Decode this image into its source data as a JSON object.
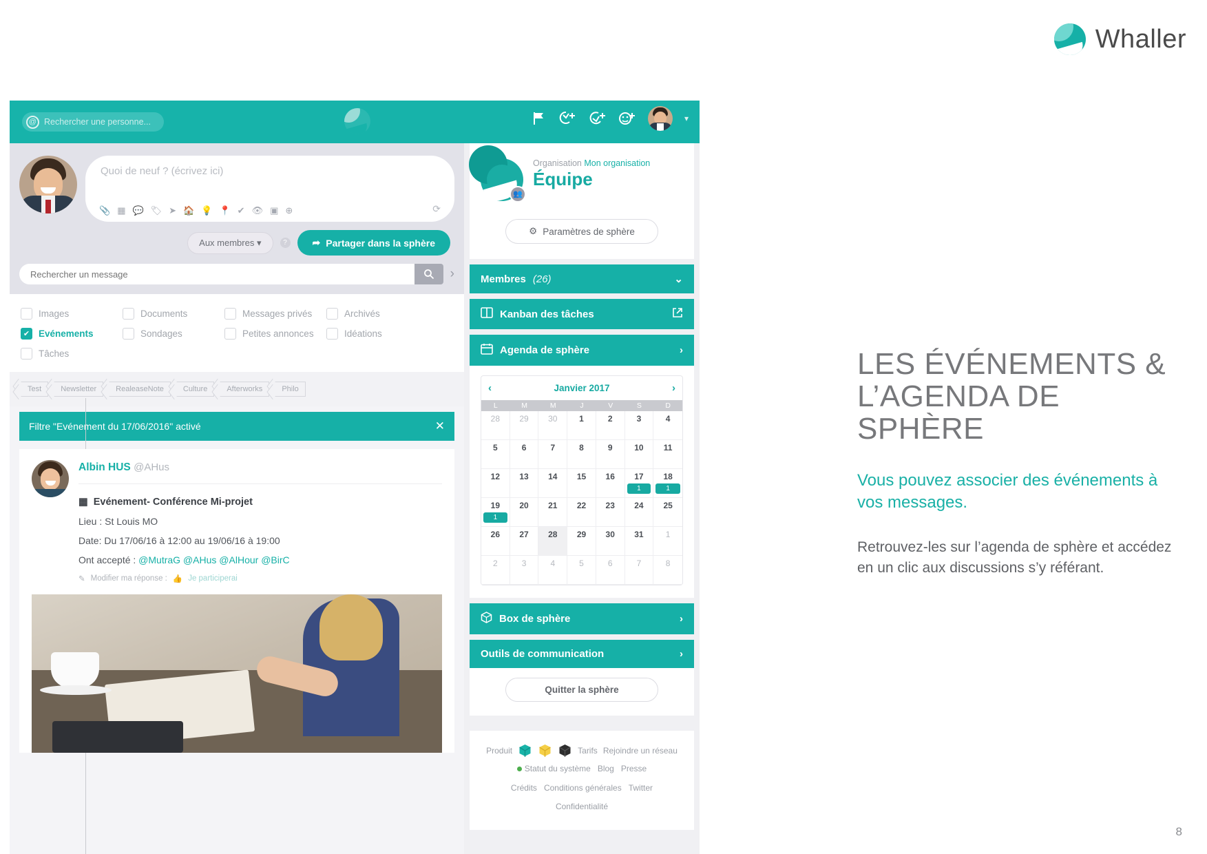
{
  "brand": {
    "name": "Whaller",
    "logo_icon": "whaller-logo-icon",
    "color": "#16b0a7"
  },
  "page_number": "8",
  "topbar": {
    "search_placeholder": "Rechercher une personne...",
    "search_icon": "at-search-icon",
    "logo_icon": "whaller-mark-icon",
    "icons": [
      "flag-icon",
      "add-sphere-icon",
      "add-circle-icon",
      "add-contact-icon"
    ],
    "avatar_icon": "user-avatar",
    "caret_icon": "chevron-down-icon"
  },
  "composer": {
    "avatar_icon": "user-avatar",
    "placeholder": "Quoi de neuf ? (écrivez ici)",
    "tools": [
      "attach-icon",
      "calendar-icon",
      "comment-icon",
      "tag-icon",
      "send-icon",
      "poll-icon",
      "idea-icon",
      "location-icon",
      "check-icon",
      "eye-icon",
      "media-icon",
      "plus-icon"
    ],
    "refresh_icon": "refresh-icon",
    "audience_label": "Aux membres",
    "audience_caret": "caret-down-icon",
    "help_icon": "help-icon",
    "share_label": "Partager dans la sphère",
    "share_icon": "share-arrow-icon"
  },
  "message_search": {
    "placeholder": "Rechercher un message",
    "value": "",
    "search_icon": "magnifier-icon",
    "next_icon": "chevron-right-icon"
  },
  "filters": [
    {
      "label": "Images",
      "checked": false
    },
    {
      "label": "Documents",
      "checked": false
    },
    {
      "label": "Messages privés",
      "checked": false
    },
    {
      "label": "Archivés",
      "checked": false
    },
    {
      "label": "Evénements",
      "checked": true
    },
    {
      "label": "Sondages",
      "checked": false
    },
    {
      "label": "Petites annonces",
      "checked": false
    },
    {
      "label": "Idéations",
      "checked": false
    },
    {
      "label": "Tâches",
      "checked": false
    }
  ],
  "tags": [
    "Test",
    "Newsletter",
    "RealeaseNote",
    "Culture",
    "Afterworks",
    "Philo"
  ],
  "filter_banner": {
    "text": "Filtre \"Evénement du 17/06/2016\" activé",
    "close_icon": "close-icon"
  },
  "post": {
    "avatar_icon": "user-avatar",
    "author": "Albin HUS",
    "handle": "@AHus",
    "event_icon": "calendar-icon",
    "title": "Evénement- Conférence Mi-projet",
    "place": "Lieu : St Louis MO",
    "date": "Date: Du 17/06/16 à 12:00 au 19/06/16 à 19:00",
    "accepted_label": "Ont accepté :",
    "accepted": [
      "@MutraG",
      "@AHus",
      "@AlHour",
      "@BirC"
    ],
    "response_icon": "pencil-icon",
    "response_label": "Modifier ma réponse :",
    "response_value_icon": "thumb-icon",
    "response_value": "Je participerai",
    "photo_alt": "photo-meeting-coffee"
  },
  "sphere": {
    "logo_icon": "sphere-logo-icon",
    "badge_icon": "group-icon",
    "org_label": "Organisation",
    "org_name": "Mon organisation",
    "name": "Équipe",
    "settings_label": "Paramètres de sphère",
    "settings_icon": "gear-icon",
    "rows": [
      {
        "label": "Membres",
        "count": "(26)",
        "icon": null,
        "right_icon": "chevron-down-icon"
      },
      {
        "label": "Kanban des tâches",
        "count": "",
        "icon": "columns-icon",
        "right_icon": "external-link-icon"
      },
      {
        "label": "Agenda de sphère",
        "count": "",
        "icon": "calendar-icon",
        "right_icon": "chevron-right-icon"
      }
    ],
    "rows_after": [
      {
        "label": "Box de sphère",
        "icon": "box-icon",
        "right_icon": "chevron-right-icon"
      },
      {
        "label": "Outils de communication",
        "icon": null,
        "right_icon": "chevron-right-icon"
      }
    ],
    "quit_label": "Quitter la sphère"
  },
  "calendar": {
    "month": "Janvier 2017",
    "prev_icon": "chevron-left-icon",
    "next_icon": "chevron-right-icon",
    "dow": [
      "L",
      "M",
      "M",
      "J",
      "V",
      "S",
      "D"
    ],
    "weeks": [
      [
        {
          "d": "28",
          "muted": true
        },
        {
          "d": "29",
          "muted": true
        },
        {
          "d": "30",
          "muted": true
        },
        {
          "d": "1"
        },
        {
          "d": "2"
        },
        {
          "d": "3"
        },
        {
          "d": "4"
        }
      ],
      [
        {
          "d": "5"
        },
        {
          "d": "6"
        },
        {
          "d": "7"
        },
        {
          "d": "8"
        },
        {
          "d": "9"
        },
        {
          "d": "10"
        },
        {
          "d": "11"
        }
      ],
      [
        {
          "d": "12"
        },
        {
          "d": "13"
        },
        {
          "d": "14"
        },
        {
          "d": "15"
        },
        {
          "d": "16"
        },
        {
          "d": "17",
          "badge": "1"
        },
        {
          "d": "18",
          "badge": "1"
        }
      ],
      [
        {
          "d": "19",
          "badge": "1"
        },
        {
          "d": "20"
        },
        {
          "d": "21"
        },
        {
          "d": "22"
        },
        {
          "d": "23"
        },
        {
          "d": "24"
        },
        {
          "d": "25"
        }
      ],
      [
        {
          "d": "26"
        },
        {
          "d": "27"
        },
        {
          "d": "28",
          "today": true
        },
        {
          "d": "29"
        },
        {
          "d": "30"
        },
        {
          "d": "31"
        },
        {
          "d": "1",
          "muted": true
        }
      ],
      [
        {
          "d": "2",
          "muted": true
        },
        {
          "d": "3",
          "muted": true
        },
        {
          "d": "4",
          "muted": true
        },
        {
          "d": "5",
          "muted": true
        },
        {
          "d": "6",
          "muted": true
        },
        {
          "d": "7",
          "muted": true
        },
        {
          "d": "8",
          "muted": true
        }
      ]
    ]
  },
  "footer": {
    "produit": "Produit",
    "cube_icons": [
      "cube-teal-icon",
      "cube-yellow-icon",
      "cube-black-icon"
    ],
    "tarifs": "Tarifs",
    "rejoindre": "Rejoindre un réseau",
    "statut": "Statut du système",
    "blog": "Blog",
    "presse": "Presse",
    "credits": "Crédits",
    "conditions": "Conditions générales",
    "twitter": "Twitter",
    "confidentialite": "Confidentialité"
  },
  "copy": {
    "heading": "LES ÉVÉNEMENTS & L’AGENDA DE SPHÈRE",
    "lead": "Vous pouvez associer des événements à vos messages.",
    "body": "Retrouvez-les sur l’agenda de sphère et accédez en un clic aux discussions s’y référant."
  }
}
